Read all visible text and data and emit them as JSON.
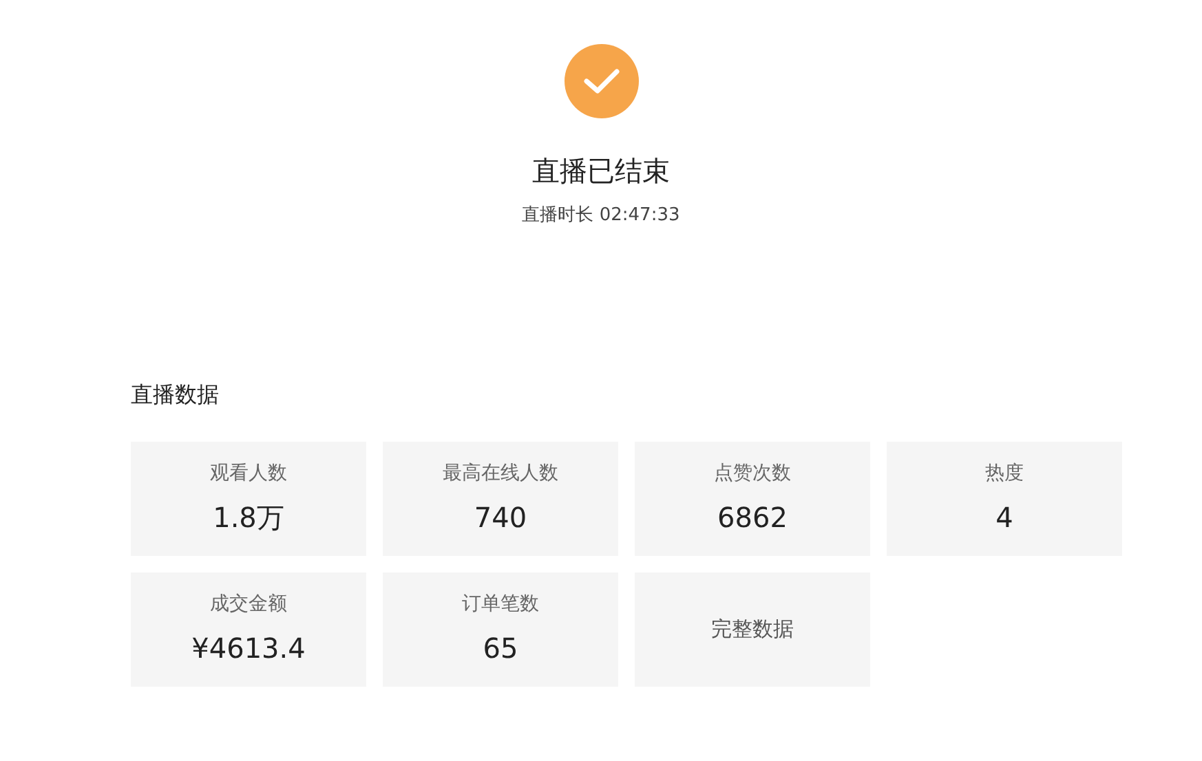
{
  "result": {
    "title": "直播已结束",
    "duration": "直播时长 02:47:33"
  },
  "section_title": "直播数据",
  "stats": [
    {
      "kind": "stat",
      "label": "观看人数",
      "value": "1.8万"
    },
    {
      "kind": "stat",
      "label": "最高在线人数",
      "value": "740"
    },
    {
      "kind": "stat",
      "label": "点赞次数",
      "value": "6862"
    },
    {
      "kind": "stat",
      "label": "热度",
      "value": "4"
    },
    {
      "kind": "stat",
      "label": "成交金额",
      "value": "¥4613.4"
    },
    {
      "kind": "stat",
      "label": "订单笔数",
      "value": "65"
    },
    {
      "kind": "link",
      "label": "完整数据"
    }
  ]
}
